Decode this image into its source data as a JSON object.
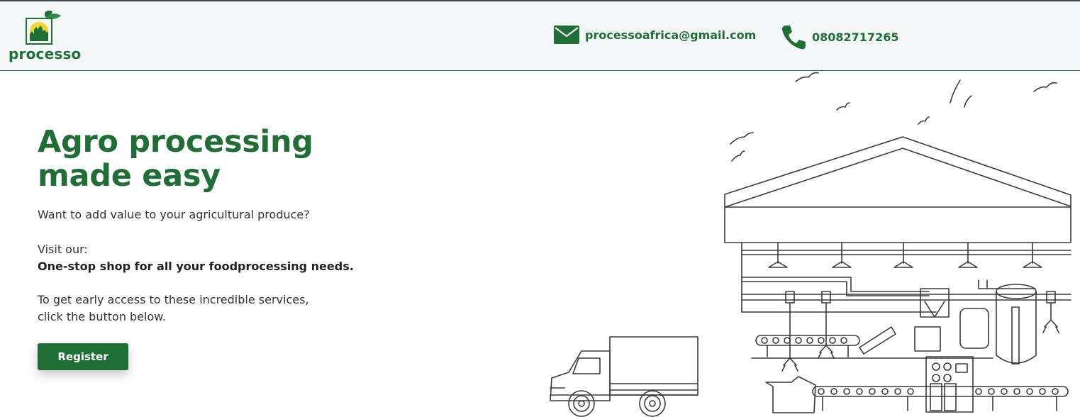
{
  "header": {
    "logo_text": "processo",
    "email": "processoafrica@gmail.com",
    "phone": "08082717265"
  },
  "hero": {
    "title_line1": "Agro processing",
    "title_line2": "made easy",
    "question": "Want to add value to your agricultural produce?",
    "visit": "Visit our:",
    "tagline": "One-stop shop for all your foodprocessing needs.",
    "early_access_line1": "To get early access to these incredible services,",
    "early_access_line2": "click the button below.",
    "register_label": "Register"
  },
  "colors": {
    "brand_green": "#1f6e36",
    "header_bg": "#f4f6f8",
    "logo_yellow": "#f2d52a"
  },
  "icons": [
    "leaf-logo-icon",
    "envelope-icon",
    "phone-icon"
  ]
}
